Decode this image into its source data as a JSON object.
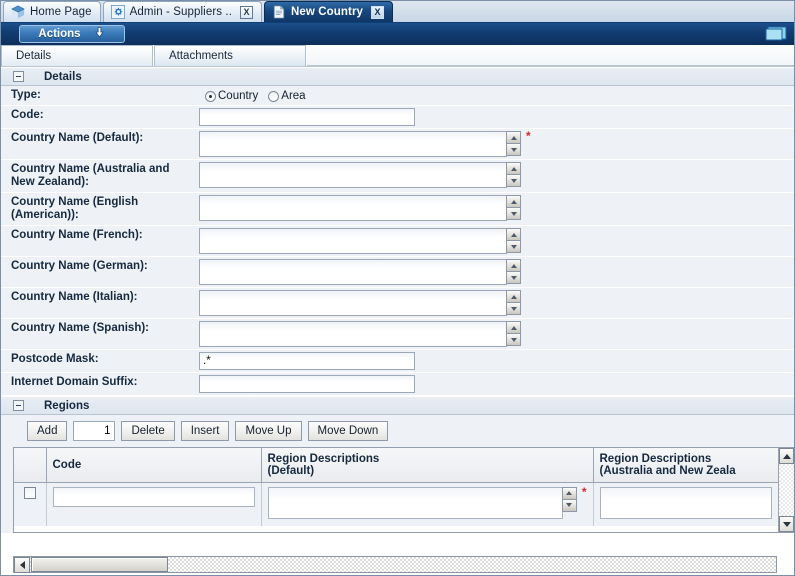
{
  "browser_tabs": [
    {
      "label": "Home Page",
      "icon": "cube-icon",
      "active": false,
      "closable": false
    },
    {
      "label": "Admin - Suppliers ..",
      "icon": "gear-icon",
      "active": false,
      "closable": true,
      "close_label": "X"
    },
    {
      "label": "New Country",
      "icon": "document-icon",
      "active": true,
      "closable": true,
      "close_label": "X"
    }
  ],
  "actionbar": {
    "actions_label": "Actions",
    "dropdown_icon": "arrow-down-icon",
    "window_icon": "window-restore-icon"
  },
  "inner_tabs": [
    {
      "label": "Details",
      "selected": true
    },
    {
      "label": "Attachments",
      "selected": false
    }
  ],
  "details_section": {
    "title": "Details",
    "collapse_icon": "collapse-minus-icon",
    "type_row": {
      "label": "Type:",
      "options": [
        {
          "label": "Country",
          "selected": true
        },
        {
          "label": "Area",
          "selected": false
        }
      ]
    },
    "fields": [
      {
        "label": "Code:",
        "value": "",
        "kind": "input",
        "required": false,
        "spinner": false,
        "focused": true
      },
      {
        "label": "Country Name\n(Default):",
        "value": "",
        "kind": "textarea",
        "required": true,
        "spinner": true
      },
      {
        "label": "Country Name\n(Australia and New Zealand):",
        "value": "",
        "kind": "textarea",
        "required": false,
        "spinner": true
      },
      {
        "label": "Country Name\n(English (American)):",
        "value": "",
        "kind": "textarea",
        "required": false,
        "spinner": true
      },
      {
        "label": "Country Name\n(French):",
        "value": "",
        "kind": "textarea",
        "required": false,
        "spinner": true
      },
      {
        "label": "Country Name\n(German):",
        "value": "",
        "kind": "textarea",
        "required": false,
        "spinner": true
      },
      {
        "label": "Country Name\n(Italian):",
        "value": "",
        "kind": "textarea",
        "required": false,
        "spinner": true
      },
      {
        "label": "Country Name\n(Spanish):",
        "value": "",
        "kind": "textarea",
        "required": false,
        "spinner": true
      },
      {
        "label": "Postcode Mask:",
        "value": ".*",
        "kind": "input",
        "required": false,
        "spinner": false
      },
      {
        "label": "Internet Domain Suffix:",
        "value": "",
        "kind": "input",
        "required": false,
        "spinner": false
      }
    ],
    "required_marker": "*"
  },
  "regions_section": {
    "title": "Regions",
    "collapse_icon": "collapse-minus-icon",
    "toolbar": {
      "add_label": "Add",
      "count_value": "1",
      "delete_label": "Delete",
      "insert_label": "Insert",
      "move_up_label": "Move Up",
      "move_down_label": "Move Down"
    },
    "columns": [
      {
        "label": ""
      },
      {
        "label": "Code"
      },
      {
        "label": "Region Descriptions\n(Default)"
      },
      {
        "label": "Region Descriptions\n(Australia and New Zeala"
      }
    ],
    "rows": [
      {
        "selected": false,
        "code": "",
        "desc_default": "",
        "desc_anz": "",
        "required_marker": "*"
      }
    ],
    "scroll": {
      "up_icon": "scroll-up-icon",
      "down_icon": "scroll-down-icon",
      "left_icon": "scroll-left-icon",
      "right_icon": "scroll-right-icon"
    }
  }
}
